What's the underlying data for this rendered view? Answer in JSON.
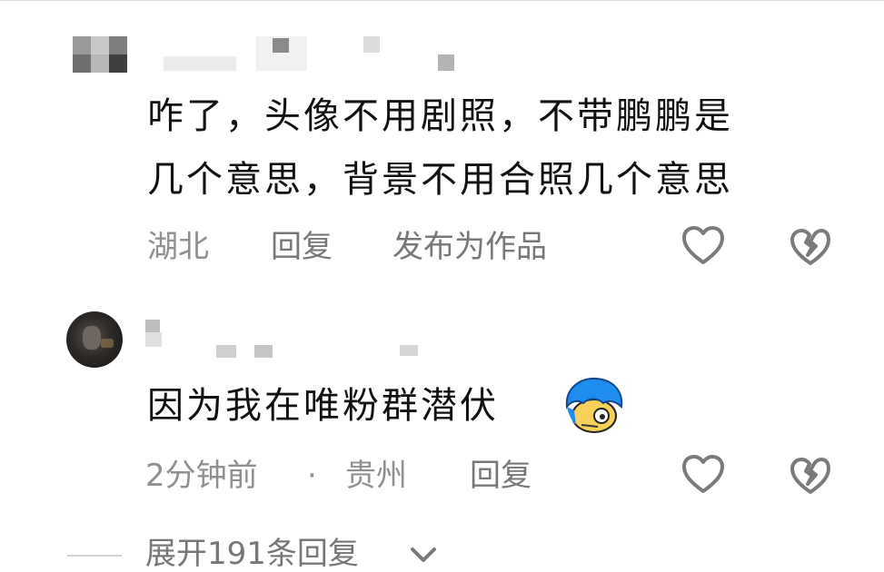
{
  "comments": [
    {
      "text_line1": "咋了，头像不用剧照，不带鹏鹏是",
      "text_line2": "几个意思，背景不用合照几个意思",
      "location": "湖北",
      "reply_label": "回复",
      "publish_label": "发布为作品"
    },
    {
      "text": "因为我在唯粉群潜伏",
      "time": "2分钟前",
      "separator": "·",
      "location": "贵州",
      "reply_label": "回复"
    }
  ],
  "expand_replies": {
    "prefix": "展开",
    "count": "191",
    "suffix": "条回复"
  },
  "icons": {
    "like": "heart-outline-icon",
    "dislike": "broken-heart-icon",
    "emoji": "blue-hair-face-emoji-icon",
    "expand": "chevron-down-icon"
  },
  "colors": {
    "text": "#111111",
    "meta": "#8f8f8f",
    "icon_stroke": "#7a7a7a"
  }
}
